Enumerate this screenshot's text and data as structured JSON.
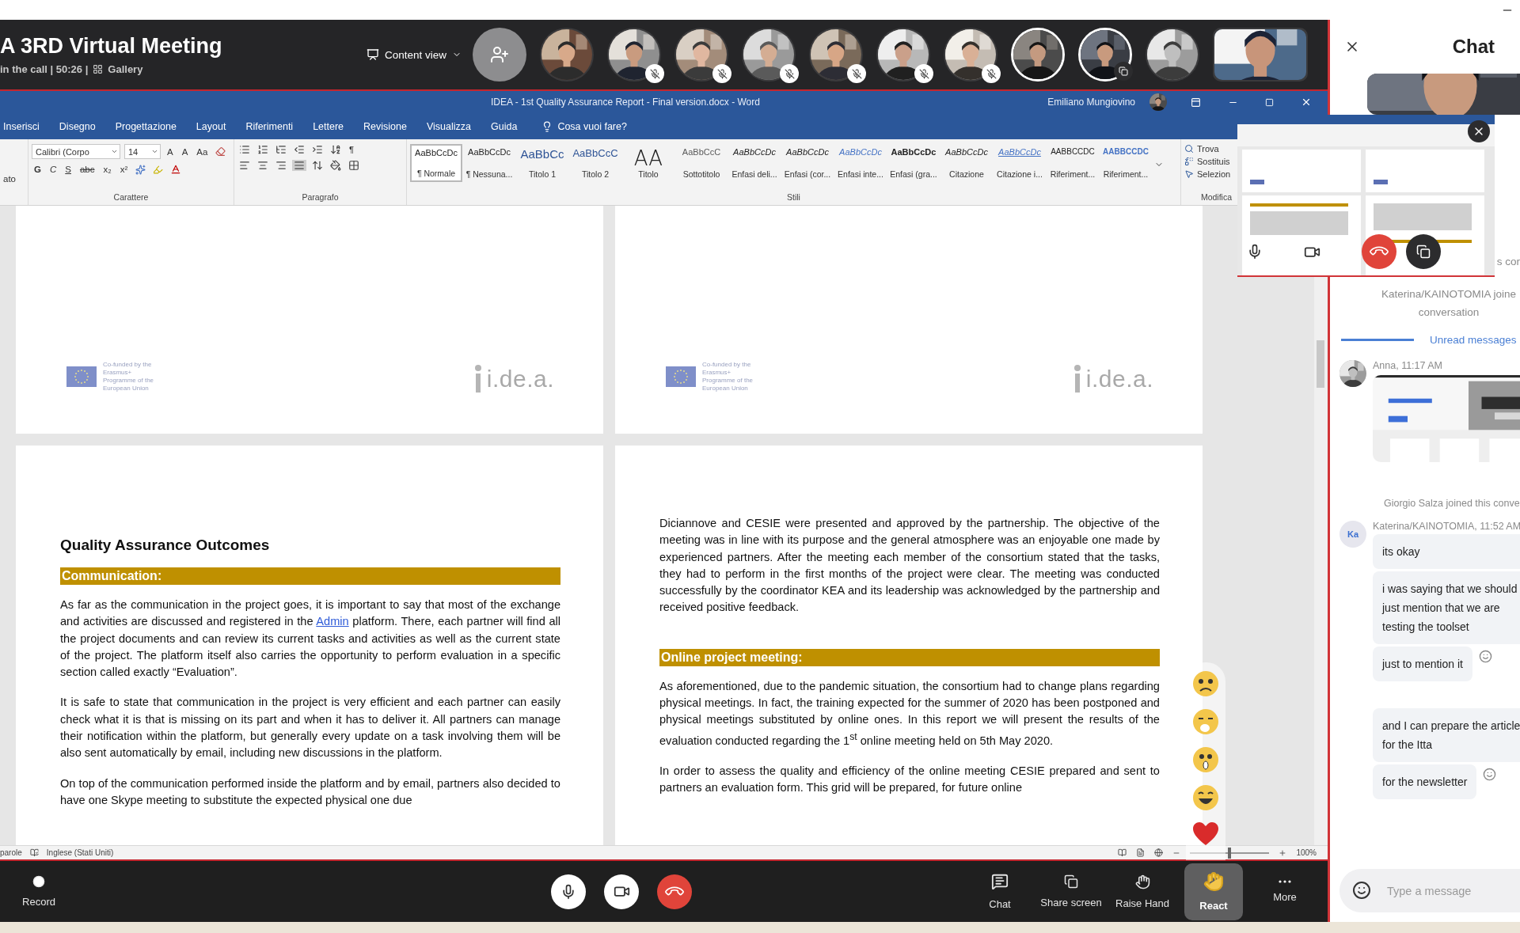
{
  "meeting": {
    "title": "A 3RD Virtual Meeting",
    "status": "in the call | 50:26 |",
    "view": "Gallery",
    "content_view": "Content view"
  },
  "participants": [
    {
      "kind": "circle",
      "muted": false,
      "highlighted": false,
      "sharing": false
    },
    {
      "kind": "circle",
      "muted": true,
      "highlighted": false,
      "sharing": false
    },
    {
      "kind": "circle",
      "muted": true,
      "highlighted": false,
      "sharing": false
    },
    {
      "kind": "circle",
      "muted": true,
      "highlighted": false,
      "sharing": false
    },
    {
      "kind": "circle",
      "muted": true,
      "highlighted": false,
      "sharing": false
    },
    {
      "kind": "circle",
      "muted": true,
      "highlighted": false,
      "sharing": false
    },
    {
      "kind": "circle",
      "muted": true,
      "highlighted": false,
      "sharing": false
    },
    {
      "kind": "circle",
      "muted": false,
      "highlighted": true,
      "sharing": false
    },
    {
      "kind": "circle",
      "muted": false,
      "highlighted": true,
      "sharing": true
    },
    {
      "kind": "circle",
      "muted": false,
      "highlighted": false,
      "sharing": false
    },
    {
      "kind": "tile",
      "muted": false,
      "highlighted": false,
      "sharing": false
    }
  ],
  "word": {
    "title": "IDEA - 1st Quality Assurance Report - Final version.docx - Word",
    "user": "Emiliano Mungiovino",
    "tabs": [
      "Inserisci",
      "Disegno",
      "Progettazione",
      "Layout",
      "Riferimenti",
      "Lettere",
      "Revisione",
      "Visualizza",
      "Guida"
    ],
    "tell_me": "Cosa vuoi fare?",
    "clipboard_label": "ato",
    "font": "Calibri (Corpo",
    "size": "14",
    "size_buttons": [
      "A",
      "A",
      "Aa"
    ],
    "format_buttons": [
      "G",
      "C",
      "S",
      "abc",
      "x₂",
      "x²"
    ],
    "pilcrow": "¶",
    "groups": [
      "Carattere",
      "Paragrafo",
      "Stili",
      "Modifica"
    ],
    "styles": [
      {
        "preview": "AaBbCcDc",
        "name": "¶ Normale",
        "kind": "body",
        "selected": true
      },
      {
        "preview": "AaBbCcDc",
        "name": "¶ Nessuna...",
        "kind": "body",
        "selected": false
      },
      {
        "preview": "AaBbCc",
        "name": "Titolo 1",
        "kind": "heading1",
        "selected": false
      },
      {
        "preview": "AaBbCcC",
        "name": "Titolo 2",
        "kind": "heading2",
        "selected": false
      },
      {
        "preview": "AA",
        "name": "Titolo",
        "kind": "title",
        "selected": false
      },
      {
        "preview": "AaBbCcC",
        "name": "Sottotitolo",
        "kind": "subtitle",
        "selected": false
      },
      {
        "preview": "AaBbCcDc",
        "name": "Enfasi deli...",
        "kind": "italic",
        "selected": false
      },
      {
        "preview": "AaBbCcDc",
        "name": "Enfasi (cor...",
        "kind": "italic",
        "selected": false
      },
      {
        "preview": "AaBbCcDc",
        "name": "Enfasi inte...",
        "kind": "accent",
        "selected": false
      },
      {
        "preview": "AaBbCcDc",
        "name": "Enfasi (gra...",
        "kind": "bold",
        "selected": false
      },
      {
        "preview": "AaBbCcDc",
        "name": "Citazione",
        "kind": "italic",
        "selected": false
      },
      {
        "preview": "AaBbCcDc",
        "name": "Citazione i...",
        "kind": "quote",
        "selected": false
      },
      {
        "preview": "AABBCCDC",
        "name": "Riferiment...",
        "kind": "caps",
        "selected": false
      },
      {
        "preview": "AABBCCDC",
        "name": "Riferiment...",
        "kind": "accentcaps",
        "selected": false
      }
    ],
    "editing": [
      "Trova",
      "Sostituis",
      "Selezion"
    ]
  },
  "top_pages": [
    {
      "eu_text": "Co-funded by the Erasmus+ Programme of the European Union",
      "logo": "i.de.a."
    },
    {
      "eu_text": "Co-funded by the Erasmus+ Programme of the European Union",
      "logo": "i.de.a."
    }
  ],
  "left_page": {
    "heading": "Quality Assurance Outcomes",
    "section": "Communication:",
    "paragraphs": [
      {
        "before": "As far as the communication in the project goes, it is important to say that most of the exchange and activities are discussed and registered in the",
        "link": "Admin",
        "after": "platform. There, each partner will find all the project documents and can review its current tasks and activities as well as the current state of the project. The platform itself also carries the opportunity to perform evaluation in a specific section called exactly “Evaluation”."
      },
      {
        "before": "It is safe to state that communication in the project is very efficient and each partner can easily check what it is that is missing on its part and when it has to deliver it. All partners can manage their notification within the platform, but generally every update on a task involving them will be also sent automatically by email, including new discussions in the platform."
      },
      {
        "before": "On top of the communication performed inside the platform and by email, partners also decided to have one Skype meeting to substitute the expected physical one due"
      }
    ]
  },
  "right_page": {
    "intro": "Diciannove and CESIE were presented and approved by the partnership. The objective of the meeting was in line with its purpose and the general atmosphere was an enjoyable one made by experienced partners. After the meeting each member of the consortium stated that the tasks, they had to perform in the first months of the project were clear. The meeting was conducted successfully by the coordinator KEA and its leadership was acknowledged by the partnership and received positive feedback.",
    "section": "Online project meeting:",
    "paragraphs": [
      "As aforementioned, due to the pandemic situation, the consortium had to change plans regarding physical meetings. In fact, the training expected for the summer of 2020 has been postponed and physical meetings substituted by online ones. In this report we will present the results of the evaluation conducted regarding the 1$^{st}$ online meeting held on 5th May 2020.",
      "In order to assess the quality and efficiency of the online meeting CESIE prepared and sent to partners an evaluation form. This grid will be prepared, for future online"
    ]
  },
  "status_bar": {
    "words": "parole",
    "language": "Inglese (Stati Uniti)",
    "zoom": "100%",
    "level": 0.5
  },
  "chat": {
    "title": "Chat",
    "cut_text": "s cor",
    "joined_lines": [
      "Katerina/KAINOTOMIA joine",
      "conversation"
    ],
    "unread": "Unread messages",
    "anna": {
      "sender": "Anna, 11:17 AM"
    },
    "giorgio": "Giorgio Salza joined this conve",
    "katerina": {
      "initials": "Ka",
      "sender": "Katerina/KAINOTOMIA, 11:52 AM",
      "groups": [
        {
          "messages": [
            "its okay",
            "i was saying that we should just mention that we are testing the toolset",
            "just to mention it"
          ]
        },
        {
          "messages": [
            "and I can prepare the article for the Itta",
            "for the newsletter"
          ]
        }
      ]
    },
    "placeholder": "Type a message"
  },
  "controls": [
    {
      "kind": "record",
      "label": "Record",
      "selected": false
    },
    {
      "kind": "mic",
      "selected": false
    },
    {
      "kind": "camera",
      "selected": false
    },
    {
      "kind": "hangup",
      "selected": false
    },
    {
      "kind": "chat",
      "label": "Chat",
      "selected": false
    },
    {
      "kind": "share",
      "label": "Share screen",
      "selected": false
    },
    {
      "kind": "hand",
      "label": "Raise Hand",
      "selected": false
    },
    {
      "kind": "react",
      "label": "React",
      "selected": true
    },
    {
      "kind": "more",
      "label": "More",
      "selected": false
    }
  ]
}
